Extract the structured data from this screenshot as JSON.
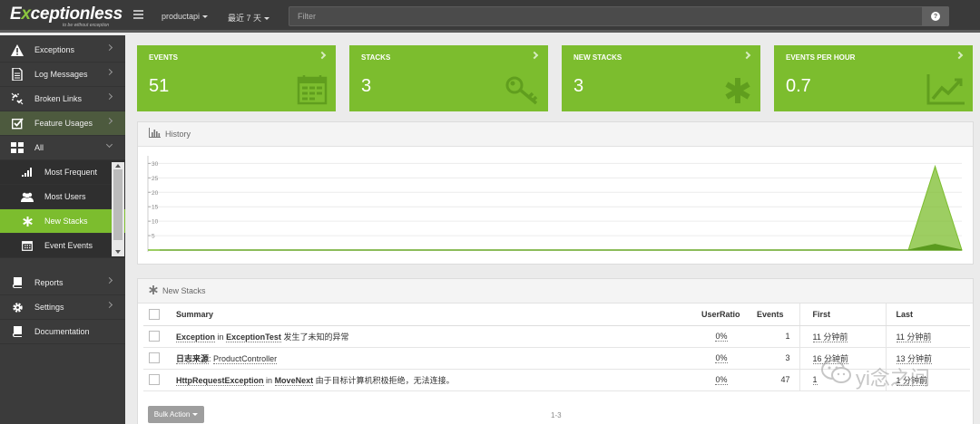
{
  "app": {
    "logo_text_first": "E",
    "logo_text_x": "x",
    "logo_text_rest": "ceptionless",
    "logo_tagline": "to be without exception"
  },
  "topbar": {
    "project": "productapi",
    "time_range": "最近 7 天",
    "filter_placeholder": "Filter",
    "filter_help": "?"
  },
  "sidebar": {
    "items": [
      {
        "label": "Exceptions",
        "icon": "warning-icon"
      },
      {
        "label": "Log Messages",
        "icon": "document-icon"
      },
      {
        "label": "Broken Links",
        "icon": "broken-link-icon"
      },
      {
        "label": "Feature Usages",
        "icon": "checkbox-icon"
      },
      {
        "label": "All",
        "icon": "grid-icon"
      },
      {
        "label": "Most Frequent",
        "icon": "signal-icon"
      },
      {
        "label": "Most Users",
        "icon": "users-icon"
      },
      {
        "label": "New Stacks",
        "icon": "asterisk-icon"
      },
      {
        "label": "Event Events",
        "icon": "calendar-icon"
      },
      {
        "label": "Reports",
        "icon": "book-icon"
      },
      {
        "label": "Settings",
        "icon": "gear-icon"
      },
      {
        "label": "Documentation",
        "icon": "book-icon"
      }
    ]
  },
  "tiles": [
    {
      "label": "EVENTS",
      "value": "51",
      "icon": "calendar-icon"
    },
    {
      "label": "STACKS",
      "value": "3",
      "icon": "key-icon"
    },
    {
      "label": "NEW STACKS",
      "value": "3",
      "icon": "asterisk-icon"
    },
    {
      "label": "EVENTS PER HOUR",
      "value": "0.7",
      "icon": "line-chart-icon"
    }
  ],
  "history": {
    "title": "History"
  },
  "chart_data": {
    "type": "area",
    "title": "History",
    "y_ticks": [
      5,
      10,
      15,
      20,
      25,
      30
    ],
    "ylim": [
      0,
      32
    ],
    "grid": true,
    "series": [
      {
        "color": "#7cbd2e",
        "values": [
          0,
          0,
          0,
          0,
          0,
          0,
          0,
          0,
          0,
          0,
          0,
          0,
          0,
          0,
          0,
          0,
          0,
          0,
          0,
          0,
          0,
          0,
          0,
          0,
          0,
          0,
          0,
          0,
          0,
          29,
          0
        ]
      },
      {
        "color": "#5a9a1f",
        "values": [
          0,
          0,
          0,
          0,
          0,
          0,
          0,
          0,
          0,
          0,
          0,
          0,
          0,
          0,
          0,
          0,
          0,
          0,
          0,
          0,
          0,
          0,
          0,
          0,
          0,
          0,
          0,
          0,
          0,
          2,
          0
        ]
      }
    ]
  },
  "stacks": {
    "title": "New Stacks",
    "columns": [
      "Summary",
      "UserRatio",
      "Events",
      "First",
      "Last"
    ],
    "rows": [
      {
        "type": "Exception",
        "in": "in",
        "method": "ExceptionTest",
        "message": "发生了未知的异常",
        "ratio": "0%",
        "events": "1",
        "first": "11 分钟前",
        "last": "11 分钟前"
      },
      {
        "type": "日志来源",
        "in": ":",
        "method": "ProductController",
        "message": "",
        "ratio": "0%",
        "events": "3",
        "first": "16 分钟前",
        "last": "13 分钟前"
      },
      {
        "type": "HttpRequestException",
        "in": "in",
        "method": "MoveNext",
        "message": "由于目标计算机积极拒绝，无法连接。",
        "ratio": "0%",
        "events": "47",
        "first": "1",
        "last": "1 分钟前"
      }
    ],
    "bulk_action": "Bulk Action",
    "pager": "1-3"
  },
  "watermark": {
    "text": "yi念之间"
  }
}
